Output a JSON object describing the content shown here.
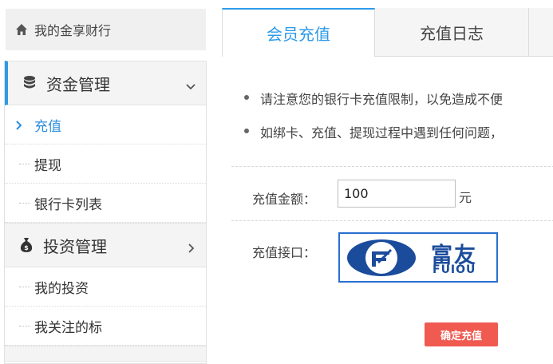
{
  "sidebar": {
    "home_label": "我的金享财行",
    "groups": [
      {
        "label": "资金管理",
        "items": [
          {
            "label": "充值"
          },
          {
            "label": "提现"
          },
          {
            "label": "银行卡列表"
          }
        ]
      },
      {
        "label": "投资管理",
        "items": [
          {
            "label": "我的投资"
          },
          {
            "label": "我关注的标"
          }
        ]
      }
    ]
  },
  "tabs": [
    {
      "label": "会员充值"
    },
    {
      "label": "充值日志"
    }
  ],
  "notices": [
    "请注意您的银行卡充值限制，以免造成不便",
    "如绑卡、充值、提现过程中遇到任何问题，"
  ],
  "form": {
    "amount_label": "充值金额：",
    "amount_value": "100",
    "unit": "元",
    "gateway_label": "充值接口：",
    "gateway_logo": {
      "cn": "富友",
      "en": "FUIOU"
    },
    "confirm_label": "确定充值"
  },
  "colors": {
    "accent": "#2d9be8",
    "confirm": "#f05a50",
    "logo_blue": "#1b4c9c"
  }
}
